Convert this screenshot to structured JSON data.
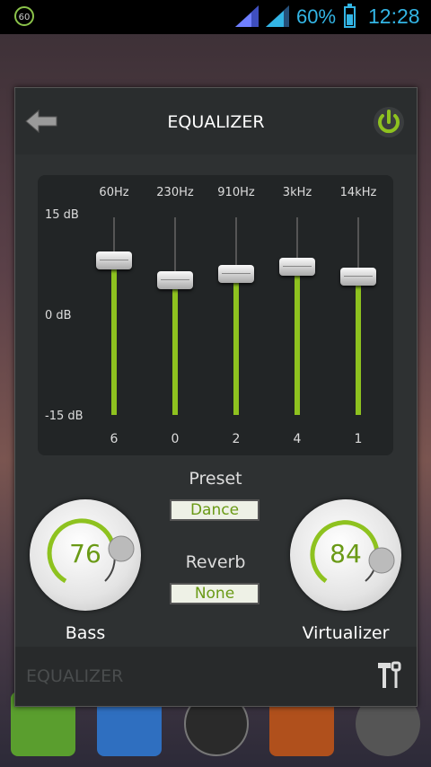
{
  "status_bar": {
    "badge": "60",
    "battery_pct": "60%",
    "battery_level": 0.6,
    "time": "12:28"
  },
  "dialog": {
    "title": "EQUALIZER",
    "footer_label": "EQUALIZER",
    "equalizer": {
      "db_max": "15 dB",
      "db_mid": "0 dB",
      "db_min": "-15 dB",
      "range_db": [
        -15,
        15
      ],
      "bands": [
        {
          "freq": "60Hz",
          "value": "6",
          "level": 6
        },
        {
          "freq": "230Hz",
          "value": "0",
          "level": 0
        },
        {
          "freq": "910Hz",
          "value": "2",
          "level": 2
        },
        {
          "freq": "3kHz",
          "value": "4",
          "level": 4
        },
        {
          "freq": "14kHz",
          "value": "1",
          "level": 1
        }
      ]
    },
    "preset": {
      "label": "Preset",
      "value": "Dance"
    },
    "reverb": {
      "label": "Reverb",
      "value": "None"
    },
    "bass": {
      "label": "Bass",
      "value": "76"
    },
    "virtualizer": {
      "label": "Virtualizer",
      "value": "84"
    }
  },
  "colors": {
    "accent": "#8ec21f",
    "status": "#33b5e5"
  },
  "icons": [
    "back-arrow-icon",
    "power-icon",
    "tools-icon",
    "signal-icon",
    "battery-icon"
  ]
}
